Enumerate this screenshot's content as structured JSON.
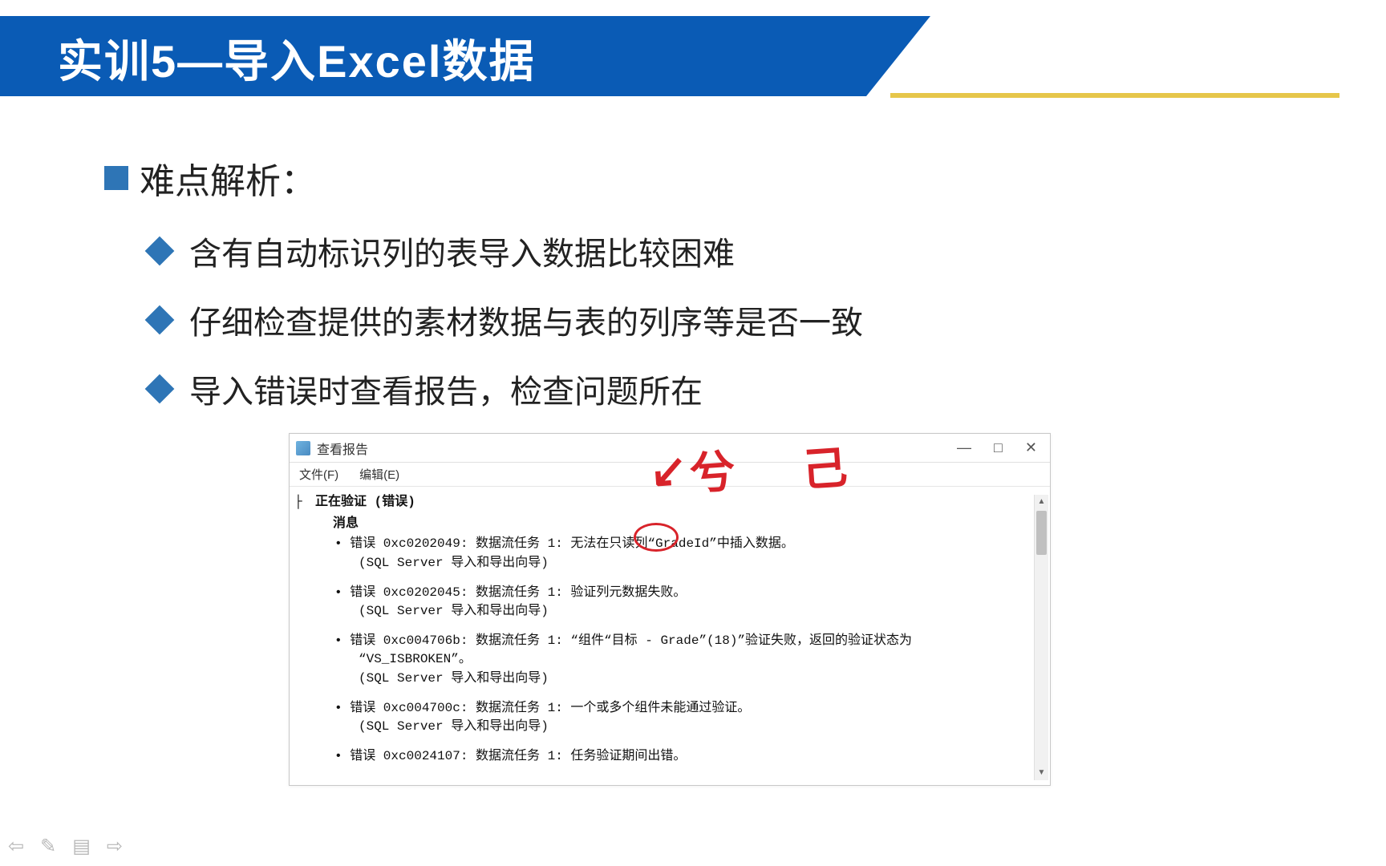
{
  "header": {
    "title": "实训5—导入Excel数据"
  },
  "body": {
    "heading": "难点解析：",
    "bullets": [
      "含有自动标识列的表导入数据比较困难",
      "仔细检查提供的素材数据与表的列序等是否一致",
      "导入错误时查看报告，检查问题所在"
    ]
  },
  "window": {
    "title": "查看报告",
    "menu_file": "文件(F)",
    "menu_edit": "编辑(E)",
    "controls": {
      "min": "—",
      "max": "□",
      "close": "✕"
    },
    "section_title": "正在验证 (错误)",
    "msg_label": "消息",
    "errors": [
      {
        "l1": "错误 0xc0202049: 数据流任务 1: 无法在只读列“GradeId”中插入数据。",
        "l2": "(SQL Server 导入和导出向导)"
      },
      {
        "l1": "错误 0xc0202045: 数据流任务 1: 验证列元数据失败。",
        "l2": "(SQL Server 导入和导出向导)"
      },
      {
        "l1": "错误 0xc004706b: 数据流任务 1: “组件“目标 - Grade”(18)”验证失败，返回的验证状态为",
        "l2": "“VS_ISBROKEN”。",
        "l3": "(SQL Server 导入和导出向导)"
      },
      {
        "l1": "错误 0xc004700c: 数据流任务 1: 一个或多个组件未能通过验证。",
        "l2": "(SQL Server 导入和导出向导)"
      },
      {
        "l1": "错误 0xc0024107: 数据流任务 1: 任务验证期间出错。"
      }
    ]
  },
  "annotations": {
    "stroke1": "兮",
    "stroke2": "己"
  },
  "footer": {
    "i1": "⇦",
    "i2": "✎",
    "i3": "▤",
    "i4": "⇨"
  }
}
